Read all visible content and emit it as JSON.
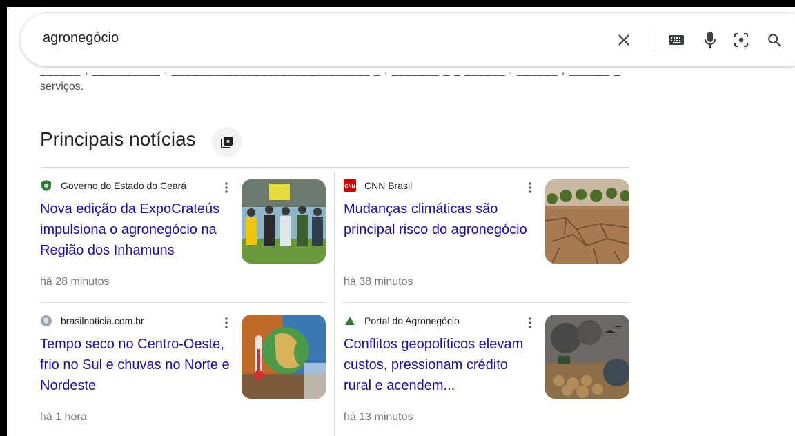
{
  "search": {
    "query": "agronegócio",
    "icons": [
      "close-icon",
      "keyboard-icon",
      "microphone-icon",
      "lens-icon",
      "search-icon"
    ]
  },
  "snippet": {
    "trailing_text": "serviços."
  },
  "top_stories": {
    "title": "Principais notícias",
    "icon": "news-icon",
    "items": [
      {
        "source": "Governo do Estado do Ceará",
        "headline": "Nova edição da ExpoCrateús impulsiona o agronegócio na Região dos Inhamuns",
        "time": "há 28 minutos",
        "favicon": "shield-icon"
      },
      {
        "source": "CNN Brasil",
        "headline": "Mudanças climáticas são principal risco do agronegócio",
        "time": "há 38 minutos",
        "favicon": "cnn-logo-icon",
        "favicon_color": "#cc0000"
      },
      {
        "source": "brasilnoticia.com.br",
        "headline": "Tempo seco no Centro-Oeste, frio no Sul e chuvas no Norte e Nordeste",
        "time": "há 1 hora",
        "favicon": "globe-icon"
      },
      {
        "source": "Portal do Agronegócio",
        "headline": "Conflitos geopolíticos elevam custos, pressionam crédito rural e acendem...",
        "time": "há 13 minutos",
        "favicon": "triangle-icon",
        "favicon_color": "#2e7d32"
      }
    ]
  },
  "colors": {
    "link": "#1a0dab",
    "meta": "#70757a"
  }
}
